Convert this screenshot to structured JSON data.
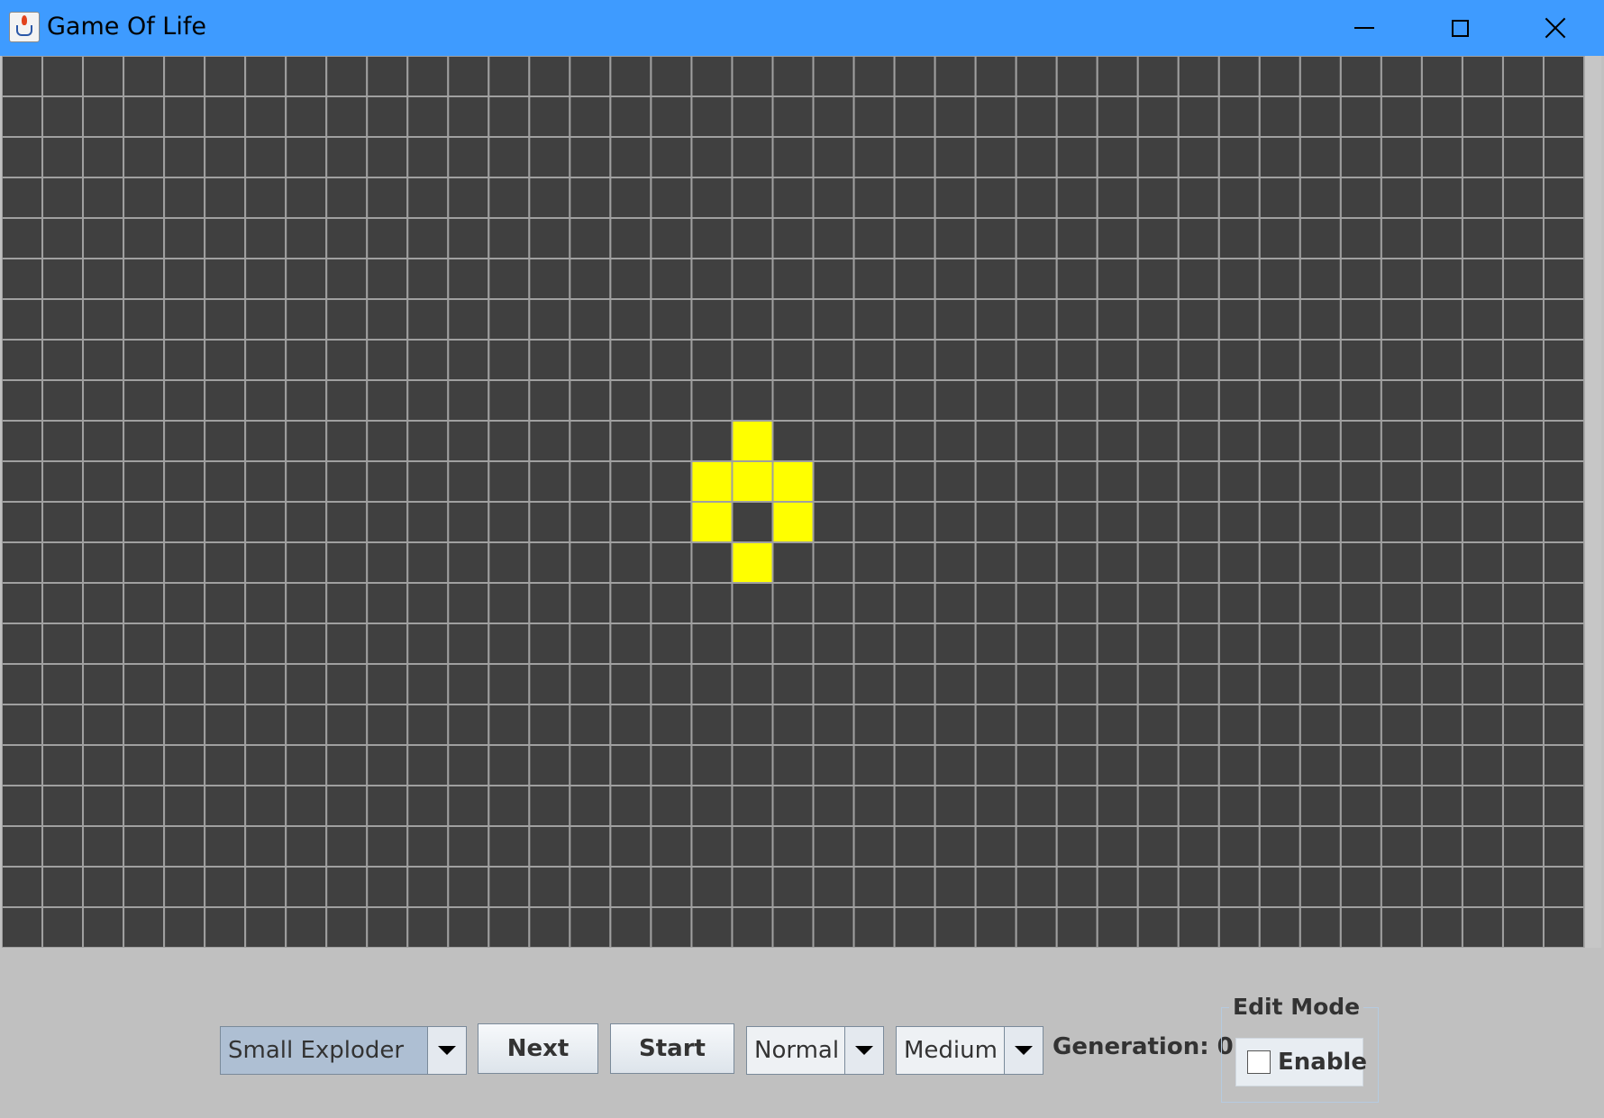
{
  "window": {
    "title": "Game Of Life",
    "title_bar_color": "#3e9bff"
  },
  "grid": {
    "columns": 39,
    "rows": 22,
    "dead_color": "#404040",
    "alive_color": "#ffff00",
    "line_color": "#a0a0a0",
    "live_cells": [
      [
        18,
        9
      ],
      [
        17,
        10
      ],
      [
        18,
        10
      ],
      [
        19,
        10
      ],
      [
        17,
        11
      ],
      [
        19,
        11
      ],
      [
        18,
        12
      ]
    ]
  },
  "controls": {
    "pattern_select": {
      "value": "Small Exploder"
    },
    "next_label": "Next",
    "start_label": "Start",
    "mode_select": {
      "value": "Normal"
    },
    "speed_select": {
      "value": "Medium"
    },
    "generation_label": "Generation: 0",
    "edit_mode": {
      "title": "Edit Mode",
      "enable_label": "Enable",
      "checked": false
    }
  }
}
